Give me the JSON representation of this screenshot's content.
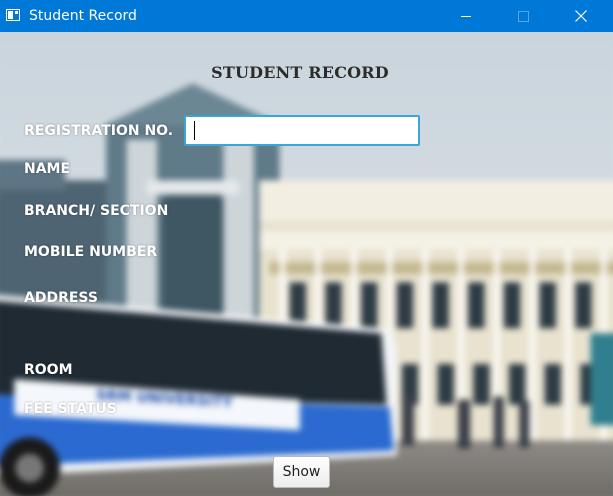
{
  "window": {
    "title": "Student Record",
    "icon": "app-window-icon",
    "controls": [
      "minimize-icon",
      "maximize-icon",
      "close-icon"
    ]
  },
  "form": {
    "heading": "STUDENT RECORD",
    "labels": {
      "registration": "REGISTRATION NO.",
      "name": "NAME",
      "branch": "BRANCH/ SECTION",
      "mobile": "MOBILE NUMBER",
      "address": "ADDRESS",
      "room": "ROOM",
      "fee": "FEE STATUS"
    },
    "registration_value": "",
    "show_label": "Show"
  },
  "background": {
    "description_icon": "campus-background-image",
    "bus_text": "SRM UNIVERSITY"
  },
  "colors": {
    "titlebar": "#0078d7",
    "input_border": "#39a6d8",
    "label_text": "#ffffff",
    "heading_text": "#2c2c2c"
  }
}
